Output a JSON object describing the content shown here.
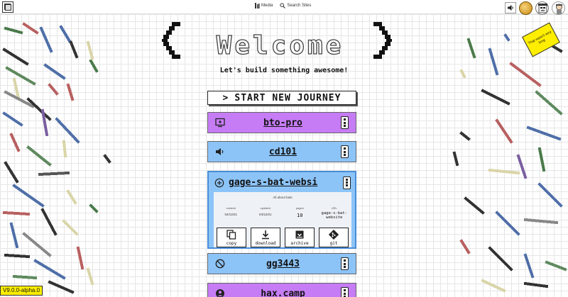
{
  "nav": {
    "media_label": "Media",
    "search_label": "Search Sites"
  },
  "sticker": {
    "text": "That wasn't very long"
  },
  "hero": {
    "title": "Welcome",
    "tagline": "Let's build something awesome!",
    "start_button": "START NEW JOURNEY",
    "start_arrow": ">"
  },
  "sites": [
    {
      "title": "bto-pro",
      "icon": "monitor-plus-icon",
      "color": "#c67cf5"
    },
    {
      "title": "cd101",
      "icon": "volume-icon",
      "color": "#8cc4f8"
    },
    {
      "title": "gage-s-bat-websi",
      "icon": "plus-circle-icon",
      "color": "#8cc4f8",
      "expanded": true,
      "description": "All about bats",
      "stats": {
        "created_label": "created",
        "created": "04/12/21",
        "updated_label": "updated",
        "updated": "04/12/21",
        "pages_label": "pages",
        "pages": "10",
        "url_label": "URL",
        "url": "gage-s-bat-website"
      },
      "actions": [
        "copy",
        "download",
        "archive",
        "git"
      ]
    },
    {
      "title": "gg3443",
      "icon": "block-icon",
      "color": "#8cc4f8"
    },
    {
      "title": "hax.camp",
      "icon": "user-circle-icon",
      "color": "#c67cf5"
    }
  ],
  "version": "V9.0.0-alpha.0",
  "colors": {
    "purple": "#c67cf5",
    "blue": "#8cc4f8",
    "sticker": "#ffee00"
  }
}
